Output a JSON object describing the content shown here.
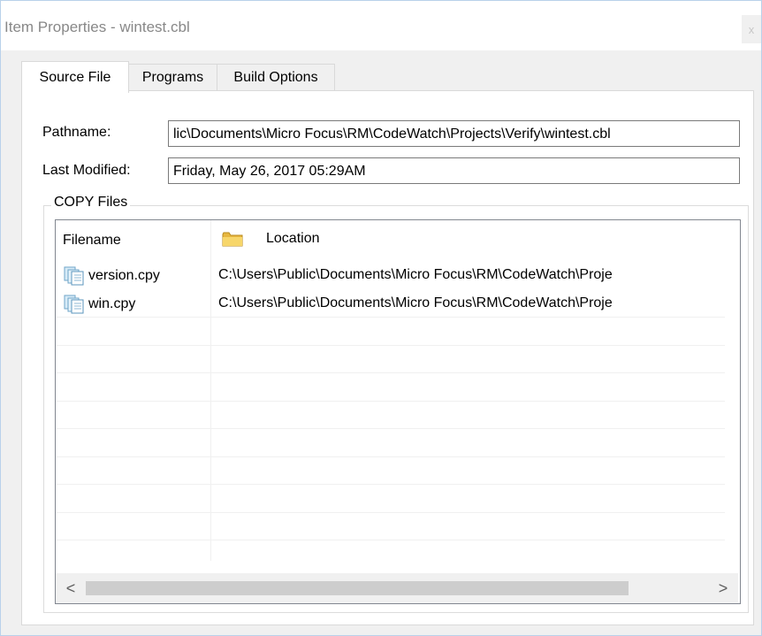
{
  "window": {
    "title": "Item Properties - wintest.cbl",
    "close_label": "x"
  },
  "tabs": [
    {
      "label": "Source File",
      "active": true
    },
    {
      "label": "Programs",
      "active": false
    },
    {
      "label": "Build Options",
      "active": false
    }
  ],
  "pathname": {
    "label": "Pathname:",
    "value": "lic\\Documents\\Micro Focus\\RM\\CodeWatch\\Projects\\Verify\\wintest.cbl"
  },
  "last_modified": {
    "label": "Last Modified:",
    "value": "Friday, May 26, 2017 05:29AM"
  },
  "copy_files": {
    "group_label": "COPY Files",
    "columns": {
      "filename": "Filename",
      "location": "Location"
    },
    "rows": [
      {
        "filename": "version.cpy",
        "location": "C:\\Users\\Public\\Documents\\Micro Focus\\RM\\CodeWatch\\Proje"
      },
      {
        "filename": "win.cpy",
        "location": "C:\\Users\\Public\\Documents\\Micro Focus\\RM\\CodeWatch\\Proje"
      }
    ],
    "scroll_left": "<",
    "scroll_right": ">"
  }
}
